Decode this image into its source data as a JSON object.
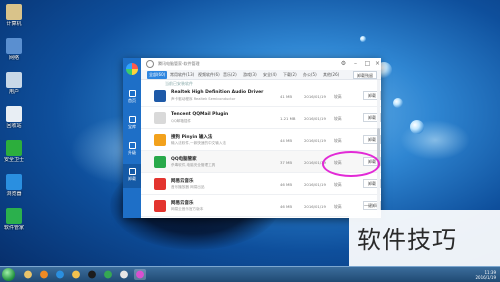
{
  "desktop": {
    "icons": [
      {
        "name": "computer-icon",
        "label": "计算机",
        "color": "#d9c38a"
      },
      {
        "name": "network-icon",
        "label": "网络",
        "color": "#5a8fd0"
      },
      {
        "name": "user-icon",
        "label": "用户",
        "color": "#c8d8e8"
      },
      {
        "name": "recycle-bin-icon",
        "label": "回收站",
        "color": "#e8eef4"
      },
      {
        "name": "security-icon",
        "label": "安全卫士",
        "color": "#2cae3c"
      },
      {
        "name": "browser-icon",
        "label": "浏览器",
        "color": "#2a8fe0"
      },
      {
        "name": "software-icon",
        "label": "软件管家",
        "color": "#2bb04d"
      }
    ]
  },
  "app": {
    "title": "腾讯电脑管家-软件管理",
    "nav": [
      {
        "name": "rail-item-home",
        "label": "首页"
      },
      {
        "name": "rail-item-repository",
        "label": "宝库"
      },
      {
        "name": "rail-item-upgrade",
        "label": "升级"
      },
      {
        "name": "rail-item-uninstall",
        "label": "卸载"
      }
    ],
    "tabs": [
      "全部(60)",
      "常用软件(13)",
      "视频软件(6)",
      "音乐(2)",
      "游戏(3)",
      "安全(4)",
      "下载(2)",
      "办公(5)",
      "其他(26)"
    ],
    "installed_mgr": "卸载残留",
    "list_note": "当前已安装软件",
    "rows": [
      {
        "name": "Realtek High Definition Audio Driver",
        "desc": "声卡驱动程序 Realtek Semiconductor",
        "size": "41 MB",
        "date": "2016/01/19",
        "freq": "较高",
        "button": "卸载",
        "icon_color": "#1e5aa8"
      },
      {
        "name": "Tencent QQMail Plugin",
        "desc": "QQ邮箱插件",
        "size": "1.21 MB",
        "date": "2016/01/19",
        "freq": "较高",
        "button": "卸载",
        "icon_color": "#d9d9d9"
      },
      {
        "name": "搜狗 Pinyin 输入法",
        "desc": "输入法软件,一款快速的中文输入法",
        "size": "44 MB",
        "date": "2016/01/19",
        "freq": "较高",
        "button": "卸载",
        "icon_color": "#f2a11c"
      },
      {
        "name": "QQ电脑管家",
        "desc": "杀毒软件,电脑安全管理工具",
        "size": "37 MB",
        "date": "2016/01/19",
        "freq": "较高",
        "button": "卸载",
        "icon_color": "#29a94a"
      },
      {
        "name": "网易云音乐",
        "desc": "音乐播放器 网易出品",
        "size": "46 MB",
        "date": "2016/01/19",
        "freq": "较高",
        "button": "卸载",
        "icon_color": "#e3342f"
      },
      {
        "name": "网易云音乐",
        "desc": "网易云音乐官方版本",
        "size": "46 MB",
        "date": "2016/01/19",
        "freq": "较高",
        "button": "一键卸载",
        "icon_color": "#e3342f"
      }
    ]
  },
  "watermark": "软件技巧",
  "taskbar": {
    "items": [
      {
        "name": "taskbar-explorer-icon",
        "color": "#e9c46a"
      },
      {
        "name": "taskbar-media-icon",
        "color": "#f08a24"
      },
      {
        "name": "taskbar-ie-icon",
        "color": "#2a8fe0"
      },
      {
        "name": "taskbar-folder-icon",
        "color": "#f2c14e"
      },
      {
        "name": "taskbar-qq-icon",
        "color": "#1c1c1c"
      },
      {
        "name": "taskbar-app-icon",
        "color": "#35a853"
      },
      {
        "name": "taskbar-manager-icon",
        "color": "#e6e6e6"
      },
      {
        "name": "taskbar-color-icon",
        "color": "#d94fd0"
      }
    ],
    "clock": "11:39",
    "date": "2016/1/19"
  }
}
